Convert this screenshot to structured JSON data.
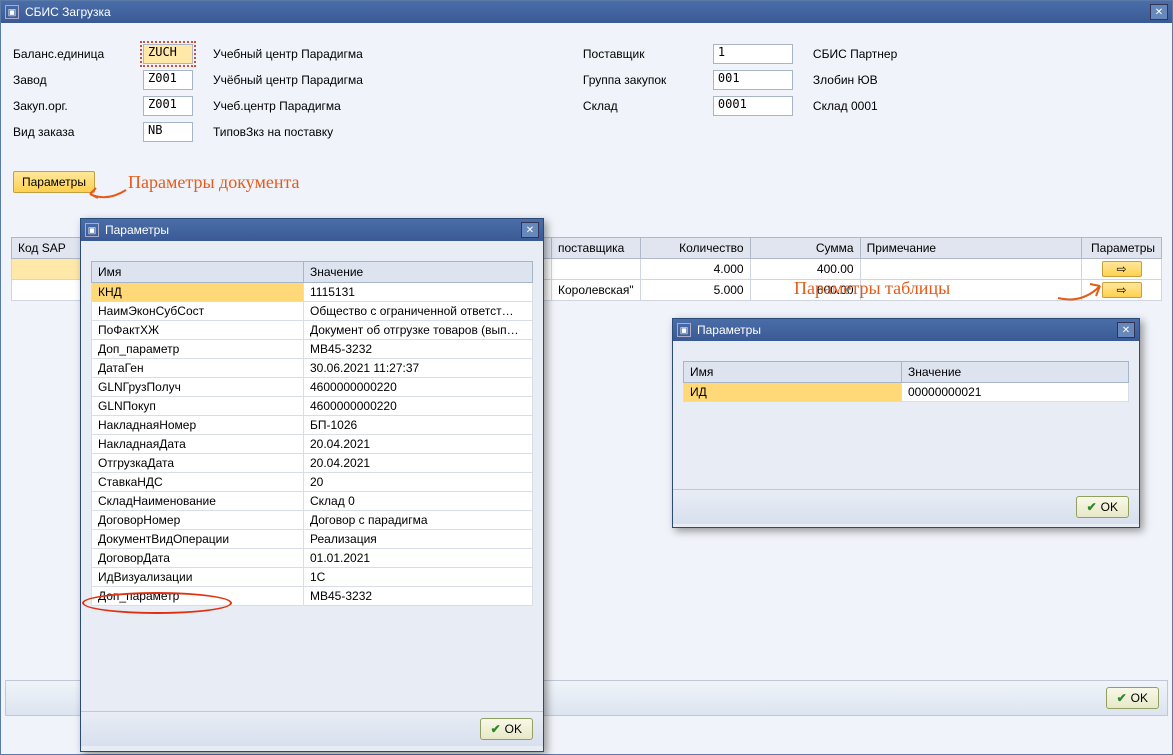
{
  "main": {
    "title": "СБИС Загрузка",
    "form": {
      "left": [
        {
          "label": "Баланс.единица",
          "value": "ZUCH",
          "desc": "Учебный центр Парадигма",
          "selected": true
        },
        {
          "label": "Завод",
          "value": "Z001",
          "desc": "Учёбный центр Парадигма"
        },
        {
          "label": "Закуп.орг.",
          "value": "Z001",
          "desc": "Учеб.центр Парадигма"
        },
        {
          "label": "Вид заказа",
          "value": "NB",
          "desc": "ТиповЗкз на поставку"
        }
      ],
      "right": [
        {
          "label": "Поставщик",
          "value": "1",
          "desc": "СБИС Партнер"
        },
        {
          "label": "Группа закупок",
          "value": "001",
          "desc": "Злобин ЮВ"
        },
        {
          "label": "Склад",
          "value": "0001",
          "desc": "Склад 0001"
        }
      ]
    },
    "params_button": "Параметры",
    "table": {
      "headers": {
        "code": "Код SAP",
        "supplier": "поставщика",
        "qty": "Количество",
        "sum": "Сумма",
        "note": "Примечание",
        "params": "Параметры"
      },
      "rows": [
        {
          "supplier": "",
          "qty": "4.000",
          "sum": "400.00",
          "note": ""
        },
        {
          "supplier": "Королевская\"",
          "qty": "5.000",
          "sum": "600.00",
          "note": ""
        }
      ]
    },
    "ok": "OK"
  },
  "dialog1": {
    "title": "Параметры",
    "headers": {
      "name": "Имя",
      "value": "Значение"
    },
    "rows": [
      {
        "name": "КНД",
        "value": "1115131",
        "selected": true
      },
      {
        "name": "НаимЭконСубСост",
        "value": "Общество с ограниченной ответст…"
      },
      {
        "name": "ПоФактХЖ",
        "value": "Документ об отгрузке товаров (вып…"
      },
      {
        "name": "Доп_параметр",
        "value": "МВ45-3232"
      },
      {
        "name": "ДатаГен",
        "value": "30.06.2021 11:27:37"
      },
      {
        "name": "GLNГрузПолуч",
        "value": "4600000000220"
      },
      {
        "name": "GLNПокуп",
        "value": "4600000000220"
      },
      {
        "name": "НакладнаяНомер",
        "value": "БП-1026"
      },
      {
        "name": "НакладнаяДата",
        "value": "20.04.2021"
      },
      {
        "name": "ОтгрузкаДата",
        "value": "20.04.2021"
      },
      {
        "name": "СтавкаНДС",
        "value": "20"
      },
      {
        "name": "СкладНаименование",
        "value": "Склад 0"
      },
      {
        "name": "ДоговорНомер",
        "value": "Договор с парадигма"
      },
      {
        "name": "ДокументВидОперации",
        "value": "Реализация"
      },
      {
        "name": "ДоговорДата",
        "value": "01.01.2021"
      },
      {
        "name": "ИдВизуализации",
        "value": "1С"
      },
      {
        "name": "Доп_параметр",
        "value": "МВ45-3232"
      }
    ],
    "ok": "OK"
  },
  "dialog2": {
    "title": "Параметры",
    "headers": {
      "name": "Имя",
      "value": "Значение"
    },
    "rows": [
      {
        "name": "ИД",
        "value": "00000000021",
        "selected": true
      }
    ],
    "ok": "OK"
  },
  "annotations": {
    "doc": "Параметры документа",
    "table": "Параметры таблицы"
  }
}
